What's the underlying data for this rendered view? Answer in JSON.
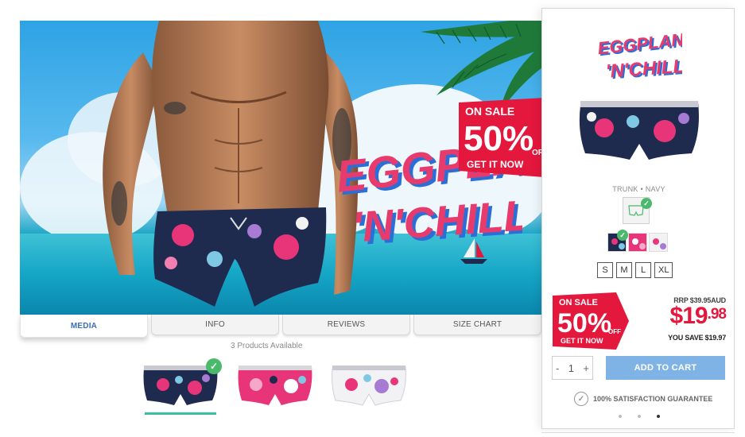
{
  "hero": {
    "logo_line1": "EGGPLANT",
    "logo_line2": "'N'CHILL",
    "banner_line1": "ON SALE",
    "banner_percent": "50%",
    "banner_off": "OFF",
    "banner_line3": "GET IT NOW"
  },
  "tabs": [
    {
      "label": "MEDIA",
      "active": true
    },
    {
      "label": "INFO",
      "active": false
    },
    {
      "label": "REVIEWS",
      "active": false
    },
    {
      "label": "SIZE CHART",
      "active": false
    }
  ],
  "products_available": "3 Products Available",
  "thumbnails": [
    {
      "name": "navy",
      "color": "#1f2a4f",
      "selected": true
    },
    {
      "name": "pink",
      "color": "#e8357a",
      "selected": false
    },
    {
      "name": "white",
      "color": "#f2f2f4",
      "selected": false
    }
  ],
  "panel": {
    "logo_line1": "EGGPLANT",
    "logo_line2": "'N'CHILL",
    "variant_text": "TRUNK • NAVY",
    "sizes": [
      "S",
      "M",
      "L",
      "XL"
    ],
    "badge_line1": "ON SALE",
    "badge_percent": "50%",
    "badge_off": "OFF",
    "badge_line3": "GET IT NOW",
    "rrp": "RRP $39.95AUD",
    "price_main": "$19",
    "price_cents": ".98",
    "you_save": "YOU SAVE $19.97",
    "qty_minus": "-",
    "qty_value": "1",
    "qty_plus": "+",
    "add_to_cart": "ADD TO CART",
    "guarantee": "100% SATISFACTION GUARANTEE",
    "check_symbol": "✓",
    "dots_count": 3,
    "active_dot": 2
  },
  "colors": {
    "brand_red": "#e4173d",
    "brand_blue": "#2b6fd6",
    "add_cart": "#7fb3e6",
    "check_green": "#4bb96b",
    "tab_active_text": "#3b6fb6"
  }
}
